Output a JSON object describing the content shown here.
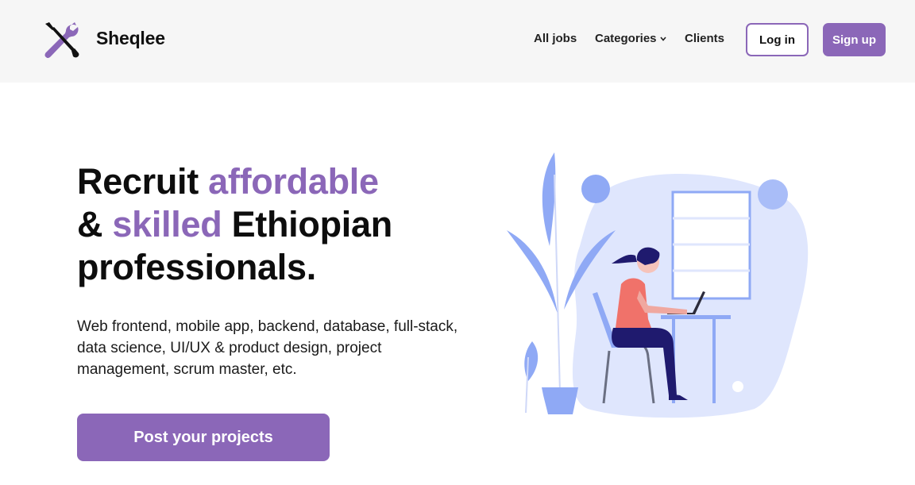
{
  "brand": {
    "name": "Sheqlee",
    "logo_icon": "tools-icon"
  },
  "nav": {
    "all_jobs": "All jobs",
    "categories": "Categories",
    "clients": "Clients",
    "login": "Log in",
    "signup": "Sign up"
  },
  "hero": {
    "title_part1": "Recruit ",
    "title_accent1": "affordable",
    "title_part2": "& ",
    "title_accent2": "skilled",
    "title_part3": " Ethiopian",
    "title_part4": "professionals.",
    "description": "Web frontend, mobile app, backend, database, full-stack, data science, UI/UX & product design, project management, scrum master, etc.",
    "cta": "Post your projects"
  },
  "colors": {
    "accent": "#8b67b8",
    "illustration_blue": "#8fa9f5",
    "illustration_bg": "#dfe6fd",
    "shirt": "#f0726a",
    "navbar_bg": "#f6f6f6"
  }
}
